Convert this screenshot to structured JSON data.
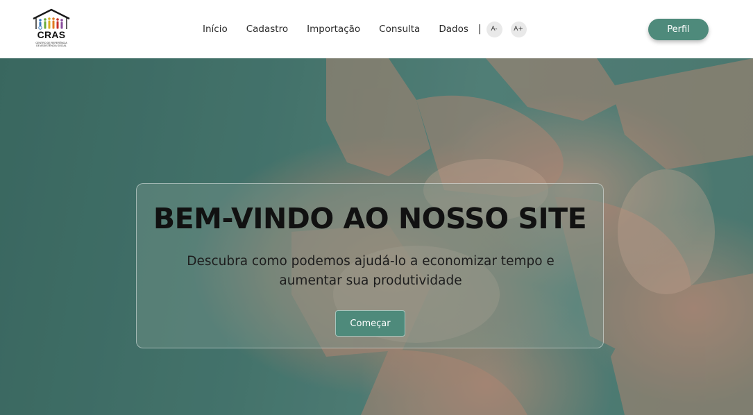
{
  "header": {
    "logo": {
      "title": "CRAS",
      "subtitle_line1": "Centro de Referência",
      "subtitle_line2": "de Assistência Social"
    },
    "nav": [
      {
        "label": "Início"
      },
      {
        "label": "Cadastro"
      },
      {
        "label": "Importação"
      },
      {
        "label": "Consulta"
      },
      {
        "label": "Dados"
      }
    ],
    "separator": "|",
    "font_decrease_label": "A-",
    "font_increase_label": "A+",
    "profile_label": "Perfil"
  },
  "hero": {
    "title": "BEM-VINDO AO NOSSO SITE",
    "subtitle": "Descubra como podemos ajudá-lo a economizar tempo e aumentar sua produtividade",
    "cta_label": "Começar"
  },
  "colors": {
    "accent": "#4e8a7b",
    "background_teal": "#4a7c74",
    "text": "#111111"
  }
}
